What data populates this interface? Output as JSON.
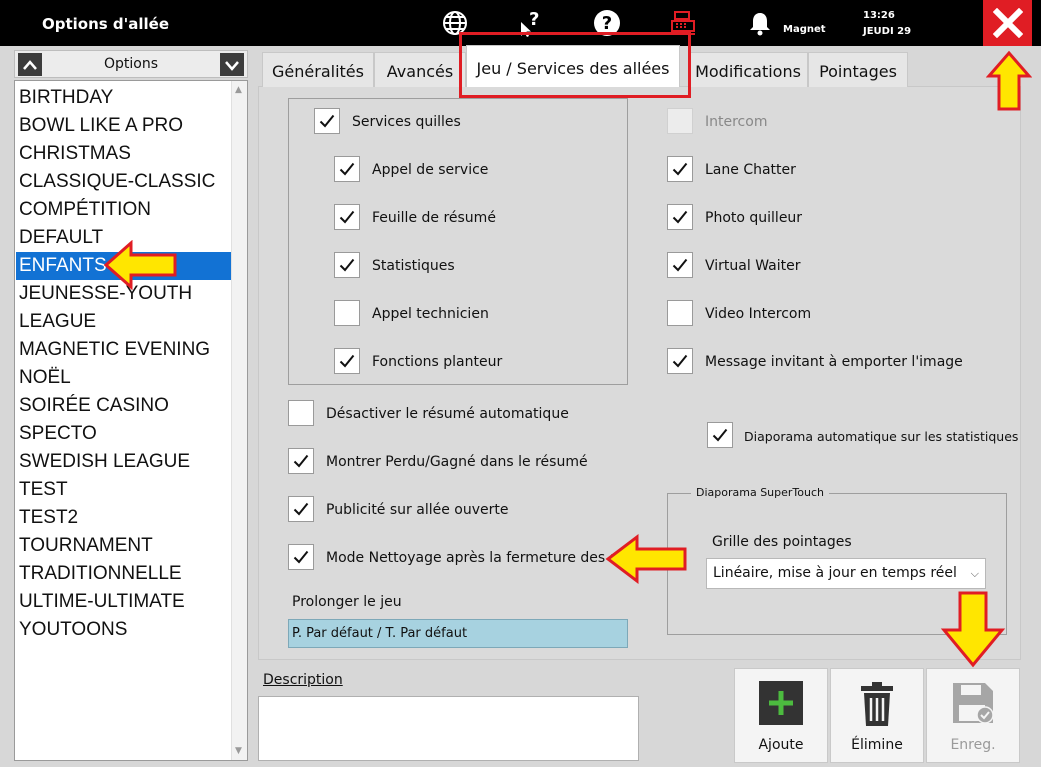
{
  "app": {
    "title": "Options d'allée",
    "user": "Magnet",
    "time": "13:26",
    "date": "JEUDI 29",
    "icons": [
      "globe-icon",
      "pointer-help-icon",
      "question-icon",
      "cash-register-icon",
      "bell-icon",
      "close-icon"
    ]
  },
  "list": {
    "header": "Options",
    "items": [
      "BIRTHDAY",
      "BOWL LIKE A PRO",
      "CHRISTMAS",
      "CLASSIQUE-CLASSIC",
      "COMPÉTITION",
      "DEFAULT",
      "ENFANTS",
      "JEUNESSE-YOUTH",
      "LEAGUE",
      "MAGNETIC EVENING",
      "NOËL",
      "SOIRÉE CASINO",
      "SPECTO",
      "SWEDISH LEAGUE",
      "TEST",
      "TEST2",
      "TOURNAMENT",
      "TRADITIONNELLE",
      "ULTIME-ULTIMATE",
      "YOUTOONS"
    ],
    "selected": "ENFANTS"
  },
  "tabs": [
    {
      "label": "Généralités"
    },
    {
      "label": "Avancés"
    },
    {
      "label": "Jeu / Services des allées"
    },
    {
      "label": "Modifications"
    },
    {
      "label": "Pointages"
    }
  ],
  "active_tab": "Jeu / Services des allées",
  "checkboxes": {
    "services_quilles": {
      "label": "Services quilles",
      "checked": true
    },
    "appel_service": {
      "label": "Appel de service",
      "checked": true
    },
    "feuille_resume": {
      "label": "Feuille de résumé",
      "checked": true
    },
    "statistiques": {
      "label": "Statistiques",
      "checked": true
    },
    "appel_technicien": {
      "label": "Appel technicien",
      "checked": false
    },
    "fonctions_planteur": {
      "label": "Fonctions planteur",
      "checked": true
    },
    "intercom": {
      "label": "Intercom",
      "checked": false,
      "disabled": true
    },
    "lane_chatter": {
      "label": "Lane Chatter",
      "checked": true
    },
    "photo_quilleur": {
      "label": "Photo quilleur",
      "checked": true
    },
    "virtual_waiter": {
      "label": "Virtual Waiter",
      "checked": true
    },
    "video_intercom": {
      "label": "Video Intercom",
      "checked": false
    },
    "message_emporter": {
      "label": "Message invitant à emporter l'image",
      "checked": true
    },
    "desactiver_resume": {
      "label": "Désactiver le résumé automatique",
      "checked": false
    },
    "diaporama_stats": {
      "label": "Diaporama automatique sur les statistiques",
      "checked": true
    },
    "montrer_perdu": {
      "label": "Montrer Perdu/Gagné dans le résumé",
      "checked": true
    },
    "publicite": {
      "label": "Publicité sur allée ouverte",
      "checked": true
    },
    "mode_nettoyage": {
      "label": "Mode Nettoyage après la fermeture des allées",
      "checked": true
    }
  },
  "prolonger": {
    "label": "Prolonger le jeu",
    "value": "P. Par défaut / T. Par défaut"
  },
  "diaporama_group": {
    "label": "Diaporama SuperTouch",
    "grille_label": "Grille des pointages",
    "grille_value": "Linéaire, mise à jour en temps réel"
  },
  "description": {
    "label": "Description",
    "value": ""
  },
  "buttons": {
    "ajoute": "Ajoute",
    "elimine": "Élimine",
    "enreg": "Enreg."
  },
  "colors": {
    "selection": "#1272d4",
    "close": "#e01d24",
    "annotation": "#ffe600",
    "prolong_field": "#a7d2e0"
  }
}
